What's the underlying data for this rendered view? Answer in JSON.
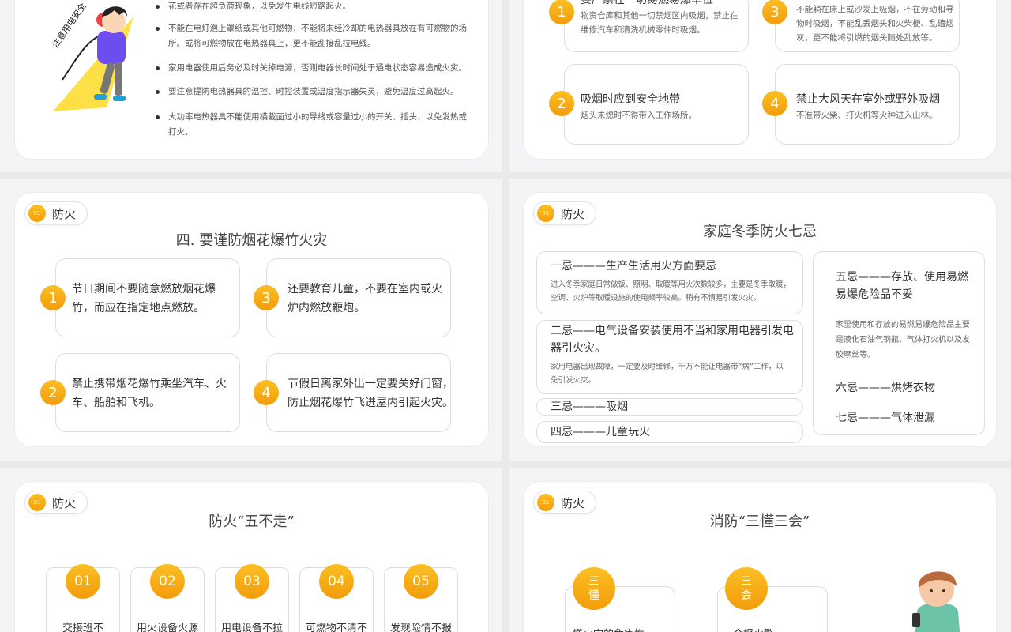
{
  "colors": {
    "accent": "#f5a00b",
    "background": "#f4f4f6"
  },
  "slide1": {
    "badge_text": "注意用电安全",
    "bullets": [
      "花或者存在超负荷现象，以免发生电线短路起火。",
      "不能在电灯泡上罩纸或其他可燃物，不能将未经冷却的电热器具放在有可燃物的场所。或将可燃物放在电热器具上，更不能乱接乱拉电线。",
      "家用电器使用后务必及时关掉电源，否则电器长时间处于通电状态容易造成火灾。",
      "要注意提防电热器具的温控、时控装置或温度指示器失灵，避免温度过高起火。",
      "大功率电热器具不能使用横截面过小的导线或容量过小的开关、插头，以免发热或打火。"
    ]
  },
  "slide2": {
    "items": [
      {
        "num": "1",
        "title": "要严禁在一切易燃易爆单位",
        "desc": "物资仓库和其他一切禁烟区内吸烟，禁止在维修汽车和清洗机械零件时吸烟。"
      },
      {
        "num": "2",
        "title": "吸烟时应到安全地带",
        "desc": "烟头未熄时不得带入工作场所。"
      },
      {
        "num": "3",
        "title": "",
        "desc": "不能躺在床上或沙发上吸烟，不在劳动和寻物时吸烟，不能乱丢烟头和火柴梗、乱磕烟灰，更不能将引燃的烟头随处乱放等。"
      },
      {
        "num": "4",
        "title": "禁止大风天在室外或野外吸烟",
        "desc": "不准带火柴、打火机等火种进入山林。"
      }
    ]
  },
  "slide3": {
    "tag_num": "01",
    "tag_label": "防火",
    "title": "四. 要谨防烟花爆竹火灾",
    "items": [
      {
        "num": "1",
        "text": "节日期间不要随意燃放烟花爆竹，而应在指定地点燃放。"
      },
      {
        "num": "2",
        "text": "禁止携带烟花爆竹乘坐汽车、火车、船舶和飞机。"
      },
      {
        "num": "3",
        "text": "还要教育儿童，不要在室内或火炉内燃放鞭炮。"
      },
      {
        "num": "4",
        "text": "节假日离家外出一定要关好门窗，防止烟花爆竹飞进屋内引起火灾。"
      }
    ]
  },
  "slide4": {
    "tag_num": "01",
    "tag_label": "防火",
    "title": "家庭冬季防火七忌",
    "ji1_title": "一忌———生产生活用火方面要忌",
    "ji1_desc": "进入冬季家庭日常做饭、照明、取暖等用火次数较多，主要是冬季取暖，空调、火炉等取暖设施的使用频率较高。稍有不慎易引发火灾。",
    "ji2_title": "二忌——电气设备安装使用不当和家用电器引发电器引火灾。",
    "ji2_desc": "家用电器出现故障，一定要及时维修，千万不能让电器带“病”工作，以免引发火灾。",
    "ji3_title": "三忌———吸烟",
    "ji4_title": "四忌———儿童玩火",
    "ji5_title": "五忌———存放、使用易燃易爆危险品不妥",
    "ji5_desc": "家里使用和存放的易燃易爆危险品主要是液化石油气钢瓶、气体打火机以及发胶摩丝等。",
    "ji6_title": "六忌———烘烤衣物",
    "ji7_title": "七忌———气体泄漏"
  },
  "slide5": {
    "tag_num": "01",
    "tag_label": "防火",
    "title": "防火“五不走”",
    "steps": [
      {
        "num": "01",
        "text": "交接班不"
      },
      {
        "num": "02",
        "text": "用火设备火源"
      },
      {
        "num": "03",
        "text": "用电设备不拉"
      },
      {
        "num": "04",
        "text": "可燃物不清不"
      },
      {
        "num": "05",
        "text": "发现险情不报"
      }
    ]
  },
  "slide6": {
    "tag_num": "01",
    "tag_label": "防火",
    "title": "消防“三懂三会”",
    "dong_top": "三",
    "dong_bottom": "懂",
    "dong_text": "懂火灾的危害性",
    "hui_top": "三",
    "hui_bottom": "会",
    "hui_text": "会报火警"
  }
}
